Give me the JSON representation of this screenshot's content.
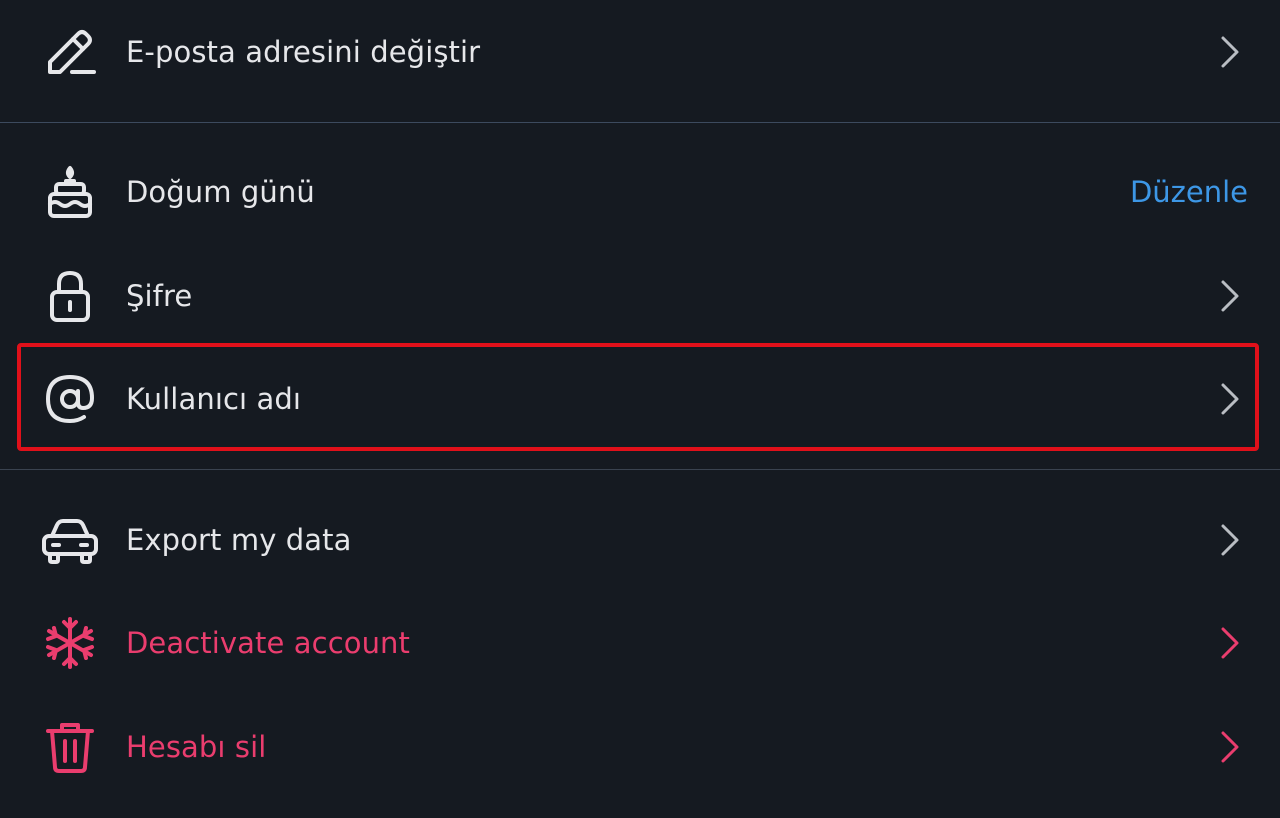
{
  "colors": {
    "background": "#151a21",
    "text": "#e6e7ea",
    "danger": "#ea3d6e",
    "link": "#3d97e6",
    "divider": "#3c4a5e",
    "divider_secondary": "#3a4350",
    "icon": "#e6e7ea",
    "chevron": "#b9bdc3",
    "highlight": "#e0101a"
  },
  "rows": [
    {
      "label": "E-posta adresini değiştir",
      "icon": "pencil-icon",
      "trailing": "chevron-right-icon"
    },
    {
      "label": "Doğum günü",
      "icon": "cake-icon",
      "action": "Düzenle"
    },
    {
      "label": "Şifre",
      "icon": "lock-icon",
      "trailing": "chevron-right-icon"
    },
    {
      "label": "Kullanıcı adı",
      "icon": "at-sign-icon",
      "trailing": "chevron-right-icon",
      "highlighted": true
    },
    {
      "label": "Export my data",
      "icon": "car-icon",
      "trailing": "chevron-right-icon"
    },
    {
      "label": "Deactivate account",
      "icon": "snowflake-icon",
      "trailing": "chevron-right-icon",
      "danger": true
    },
    {
      "label": "Hesabı sil",
      "icon": "trash-icon",
      "trailing": "chevron-right-icon",
      "danger": true
    }
  ]
}
